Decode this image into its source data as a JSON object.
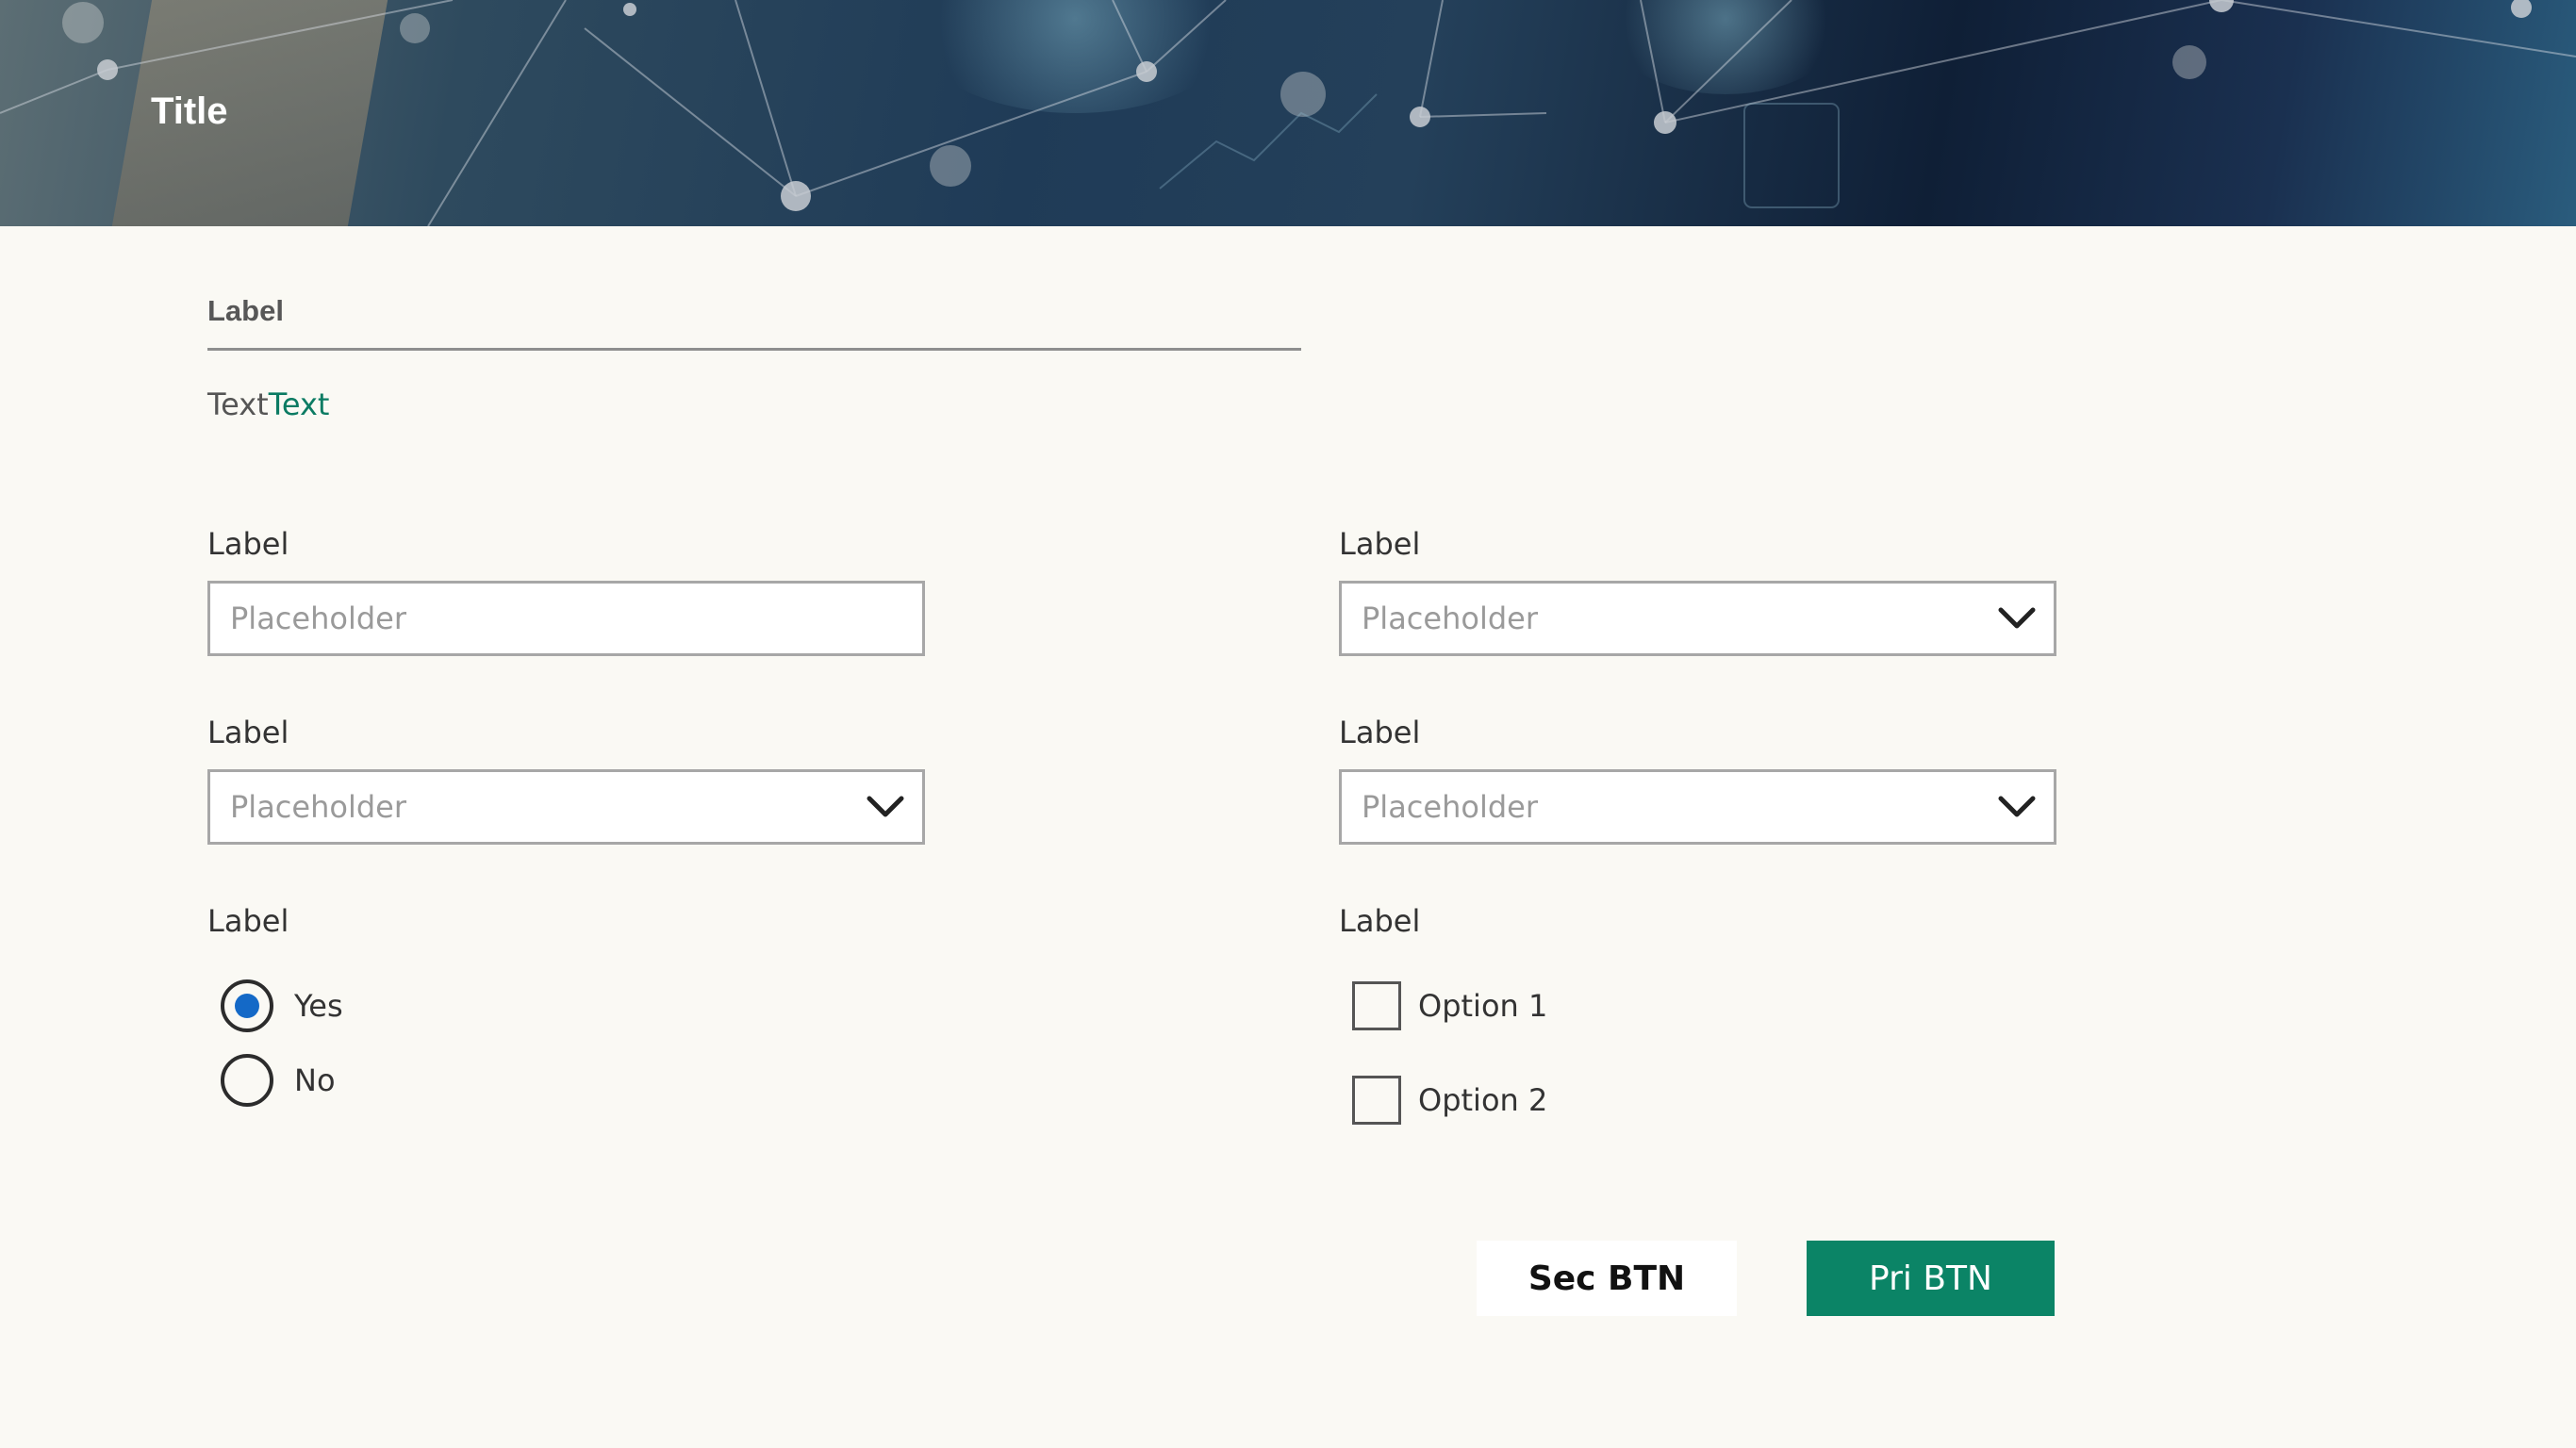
{
  "header": {
    "title": "Title"
  },
  "section": {
    "label": "Label",
    "text_primary": "Text",
    "text_accent": "Text"
  },
  "form": {
    "left": {
      "text_input": {
        "label": "Label",
        "placeholder": "Placeholder"
      },
      "dropdown": {
        "label": "Label",
        "placeholder": "Placeholder"
      },
      "radio_group": {
        "label": "Label",
        "options": [
          {
            "label": "Yes",
            "selected": true
          },
          {
            "label": "No",
            "selected": false
          }
        ]
      }
    },
    "right": {
      "dropdown_1": {
        "label": "Label",
        "placeholder": "Placeholder"
      },
      "dropdown_2": {
        "label": "Label",
        "placeholder": "Placeholder"
      },
      "checkbox_group": {
        "label": "Label",
        "options": [
          {
            "label": "Option 1",
            "checked": false
          },
          {
            "label": "Option 2",
            "checked": false
          }
        ]
      }
    }
  },
  "actions": {
    "secondary_label": "Sec BTN",
    "primary_label": "Pri BTN"
  },
  "icons": {
    "dropdown": "chevron-down-icon"
  },
  "colors": {
    "accent_green": "#0b8466",
    "accent_text": "#0b7b63",
    "radio_selected": "#1469c7",
    "background": "#faf9f4"
  }
}
